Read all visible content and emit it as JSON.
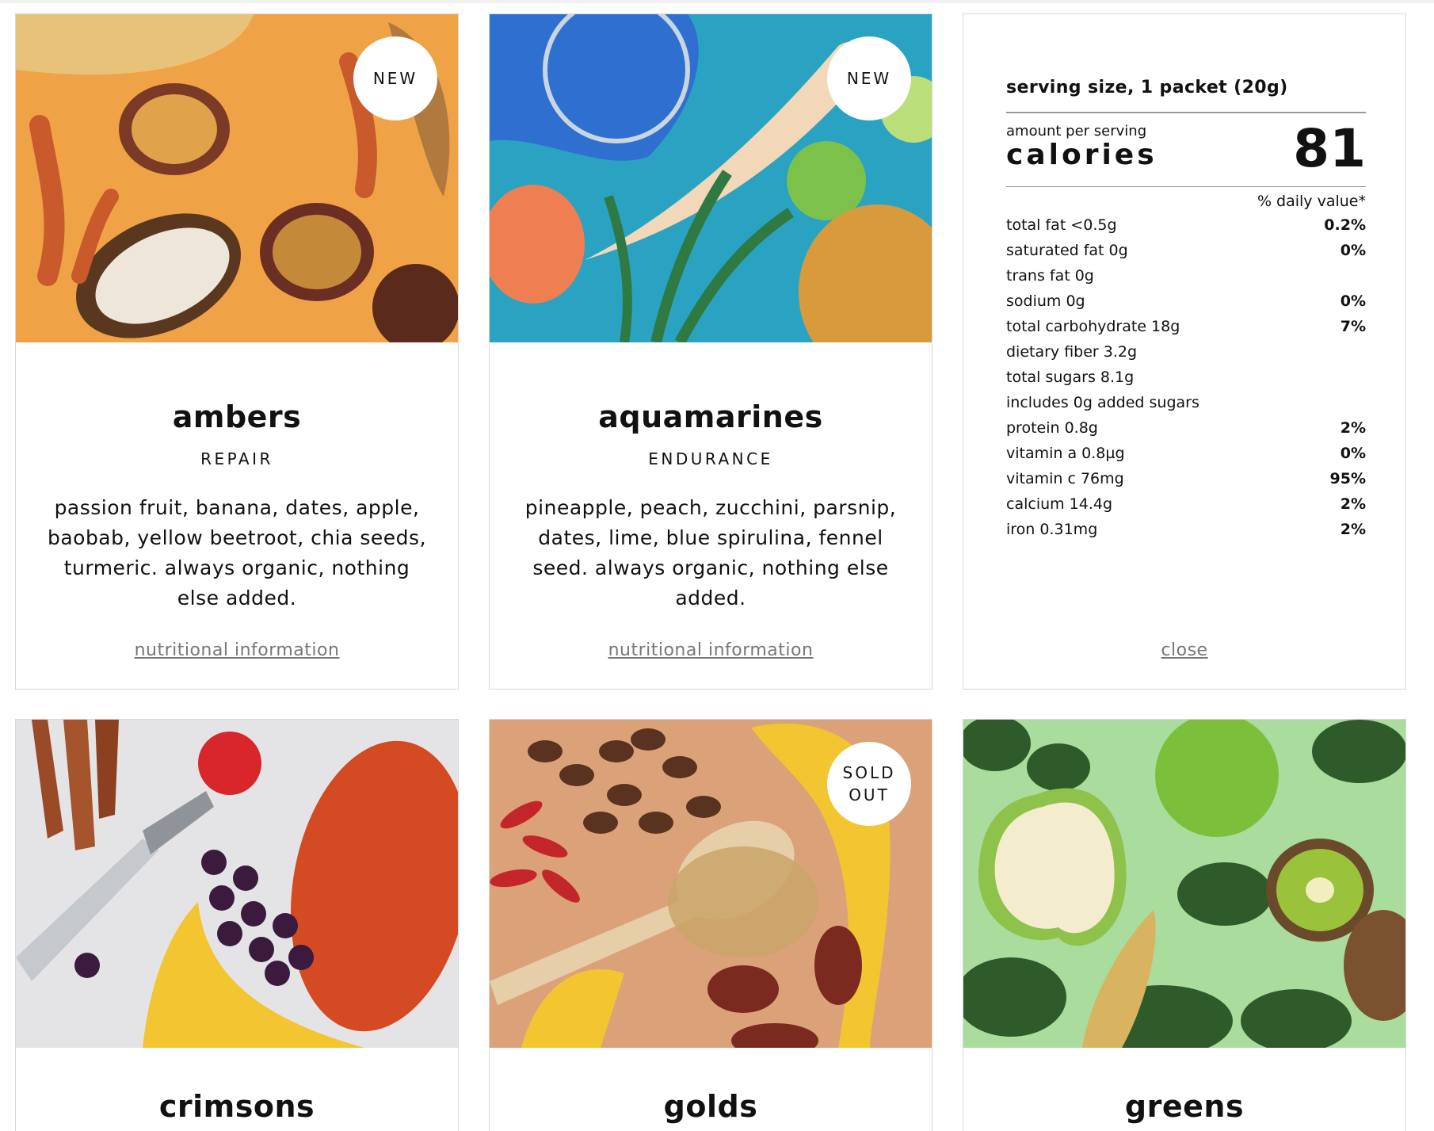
{
  "products": [
    {
      "name": "ambers",
      "benefit": "REPAIR",
      "badge": [
        "NEW"
      ],
      "description": "passion fruit, banana, dates, apple, baobab, yellow beetroot, chia seeds, turmeric. always organic, nothing else added.",
      "link": "nutritional information"
    },
    {
      "name": "aquamarines",
      "benefit": "ENDURANCE",
      "badge": [
        "NEW"
      ],
      "description": "pineapple, peach, zucchini, parsnip, dates, lime, blue spirulina, fennel seed. always organic, nothing else added.",
      "link": "nutritional information"
    },
    {
      "name": "crimsons"
    },
    {
      "name": "golds",
      "badge": [
        "SOLD",
        "OUT"
      ]
    },
    {
      "name": "greens"
    }
  ],
  "nutrition": {
    "serving_size": "serving size, 1 packet (20g)",
    "amount_label": "amount per serving",
    "calories_label": "calories",
    "calories_value": "81",
    "daily_value_label": "% daily value*",
    "rows": [
      {
        "label": "total fat <0.5g",
        "pct": "0.2%"
      },
      {
        "label": "saturated fat 0g",
        "pct": "0%"
      },
      {
        "label": "trans fat 0g",
        "pct": ""
      },
      {
        "label": "sodium 0g",
        "pct": "0%"
      },
      {
        "label": "total carbohydrate 18g",
        "pct": "7%"
      },
      {
        "label": "dietary fiber 3.2g",
        "pct": ""
      },
      {
        "label": "total sugars 8.1g",
        "pct": ""
      },
      {
        "label": "includes 0g added sugars",
        "pct": ""
      },
      {
        "label": "protein 0.8g",
        "pct": "2%"
      },
      {
        "label": "vitamin a 0.8µg",
        "pct": "0%"
      },
      {
        "label": "vitamin c 76mg",
        "pct": "95%"
      },
      {
        "label": "calcium 14.4g",
        "pct": "2%"
      },
      {
        "label": "iron 0.31mg",
        "pct": "2%"
      }
    ],
    "close_label": "close"
  },
  "colors": {
    "ambers_bg": "#f0a246",
    "aquamarines_bg": "#2aa3c3",
    "crimsons_bg": "#e4e4e6",
    "golds_bg": "#dba27a",
    "greens_bg": "#a9dc9d"
  }
}
